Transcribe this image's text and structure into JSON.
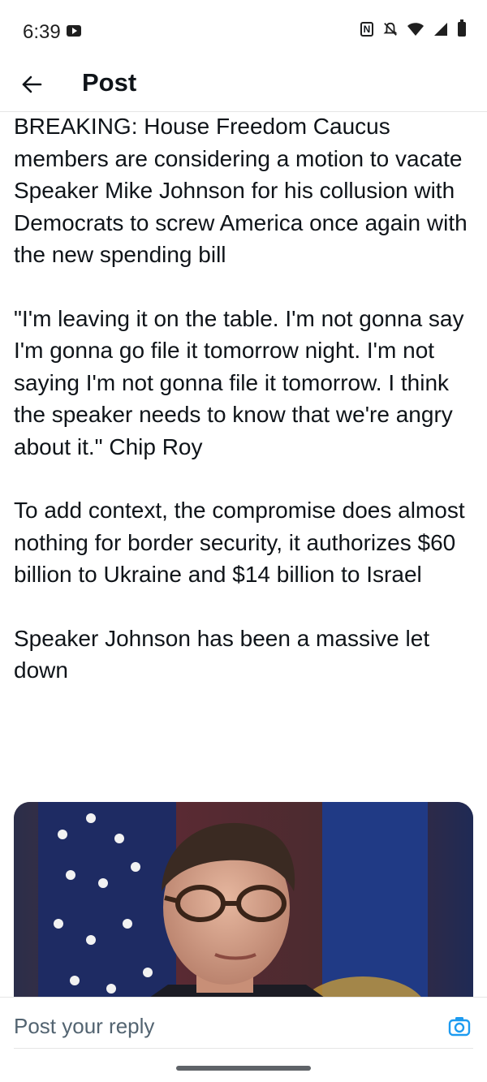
{
  "status_bar": {
    "time": "6:39",
    "icons": [
      "cast-icon",
      "nfc-icon",
      "bell-muted-icon",
      "wifi-icon",
      "cell-signal-icon",
      "battery-icon"
    ]
  },
  "header": {
    "title": "Post",
    "back_icon": "arrow-left-icon"
  },
  "post": {
    "paragraphs": [
      "BREAKING: House Freedom Caucus members are considering a motion to vacate Speaker Mike Johnson for his collusion with Democrats to screw America once again with the new spending bill",
      "\"I'm leaving it on the table. I'm not gonna say I'm gonna go file it tomorrow night. I'm not saying I'm not gonna file it tomorrow. I think the speaker needs to know that we're angry about it.\" Chip Roy",
      "To add context, the compromise does almost nothing for border security, it authorizes $60 billion to Ukraine and $14 billion to Israel",
      "Speaker Johnson has been a massive let down"
    ],
    "media": "photo-of-speaker-mike-johnson"
  },
  "reply_bar": {
    "placeholder": "Post your reply",
    "camera_icon": "camera-icon"
  },
  "colors": {
    "text": "#0f1419",
    "muted": "#536471",
    "accent": "#1d9bf0",
    "divider": "#e6e6e6"
  }
}
